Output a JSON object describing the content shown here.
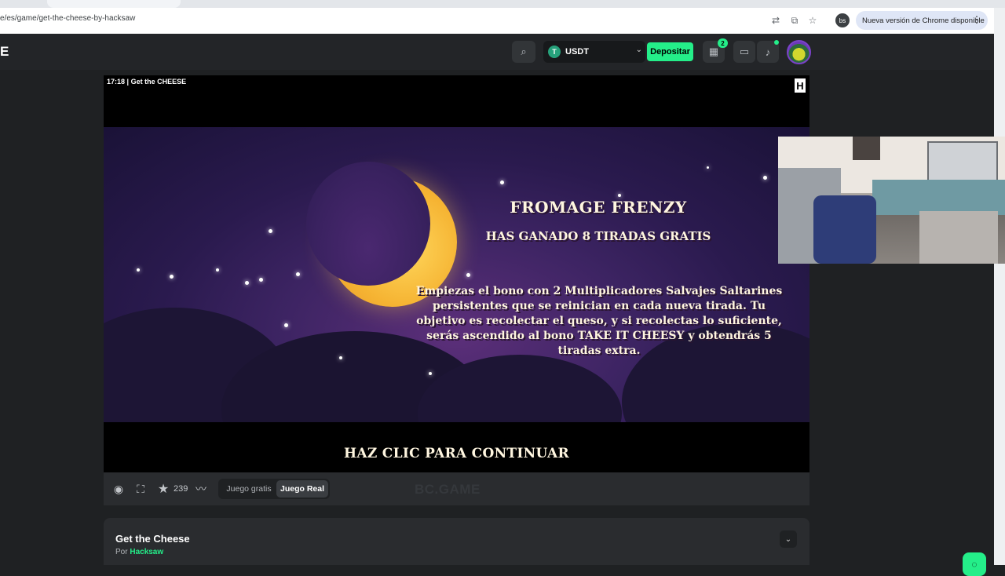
{
  "browser": {
    "url": "e/es/game/get-the-cheese-by-hacksaw",
    "profile_initials": "bs",
    "update_notice": "Nueva versión de Chrome disponible"
  },
  "header": {
    "logo_fragment": "E",
    "currency": "USDT",
    "currency_icon": "T",
    "deposit_label": "Depositar",
    "gift_badge": "2"
  },
  "game": {
    "overlay_time": "17:18",
    "overlay_title": "Get the CHEESE",
    "provider_logo": "H",
    "bonus_title": "FROMAGE FRENZY",
    "bonus_won": "HAS GANADO 8 TIRADAS GRATIS",
    "bonus_desc": "Empiezas el bono con 2 Multiplicadores Salvajes Saltarines persistentes que se reinician en cada nueva tirada. Tu objetivo es recolectar el queso, y si recolectas lo suficiente, serás ascendido al bono TAKE IT CHEESY y obtendrás 5 tiradas extra.",
    "continue_prompt": "HAZ CLIC PARA CONTINUAR"
  },
  "controls": {
    "favorite_count": "239",
    "mode_free": "Juego gratis",
    "mode_real": "Juego Real",
    "watermark": "BC.GAME"
  },
  "info": {
    "title": "Get the Cheese",
    "by_prefix": "Por",
    "provider": "Hacksaw"
  },
  "colors": {
    "accent": "#24ee89",
    "background": "#1f2123",
    "panel": "#2a2c2f"
  }
}
